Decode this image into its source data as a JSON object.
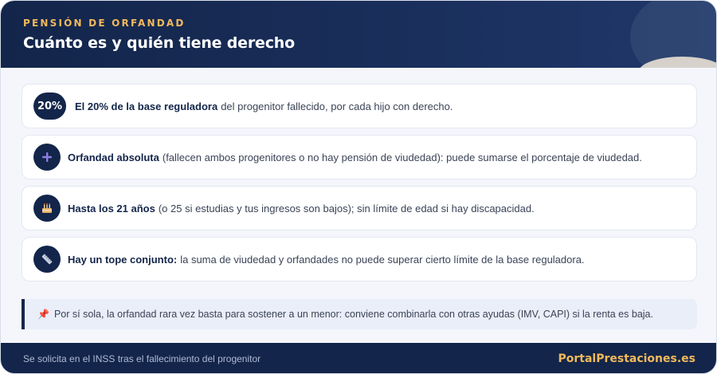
{
  "header": {
    "eyebrow": "PENSIÓN DE ORFANDAD",
    "title": "Cuánto es y quién tiene derecho"
  },
  "items": [
    {
      "badge": "20%",
      "icon": "percent-badge",
      "bold": "El 20% de la base reguladora",
      "text": "del progenitor fallecido, por cada hijo con derecho."
    },
    {
      "badge": "+",
      "icon": "plus-icon",
      "bold": "Orfandad absoluta",
      "text": "(fallecen ambos progenitores o no hay pensión de viudedad): puede sumarse el porcentaje de viudedad."
    },
    {
      "badge": "🎂",
      "icon": "birthday-cake-icon",
      "bold": "Hasta los 21 años",
      "text": "(o 25 si estudias y tus ingresos son bajos); sin límite de edad si hay discapacidad."
    },
    {
      "badge": "",
      "icon": "ruler-icon",
      "bold": "Hay un tope conjunto:",
      "text": "la suma de viudedad y orfandades no puede superar cierto límite de la base reguladora."
    }
  ],
  "note": {
    "pin": "📌",
    "icon": "pushpin-icon",
    "text": "Por sí sola, la orfandad rara vez basta para sostener a un menor: conviene combinarla con otras ayudas (IMV, CAPI) si la renta es baja."
  },
  "footer": {
    "left": "Se solicita en el INSS tras el fallecimiento del progenitor",
    "brand": "PortalPrestaciones.es"
  },
  "colors": {
    "navy": "#13254a",
    "accent": "#f2b95c",
    "background": "#f4f6fb",
    "plus": "#8b7fe0"
  }
}
